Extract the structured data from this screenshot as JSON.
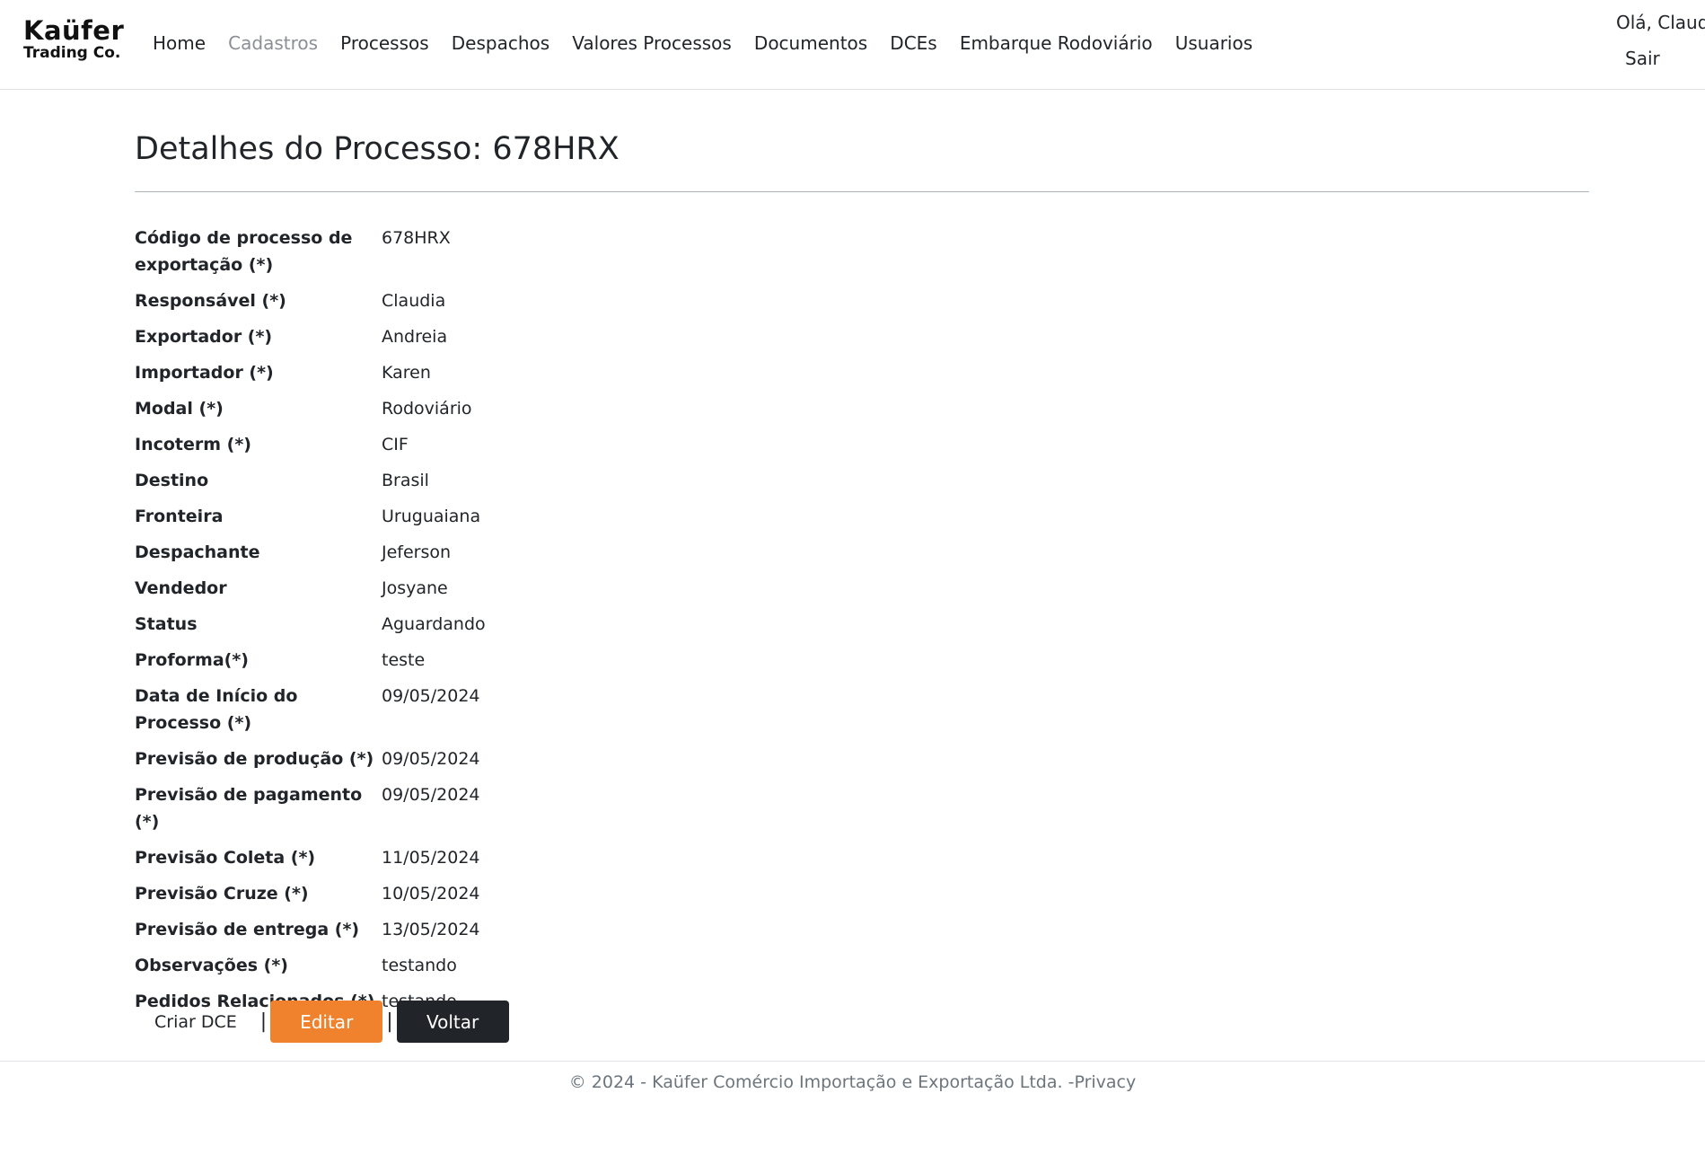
{
  "brand": {
    "line1": "Kaüfer",
    "line2": "Trading Co."
  },
  "nav": {
    "items": [
      {
        "label": "Home"
      },
      {
        "label": "Cadastros"
      },
      {
        "label": "Processos"
      },
      {
        "label": "Despachos"
      },
      {
        "label": "Valores Processos"
      },
      {
        "label": "Documentos"
      },
      {
        "label": "DCEs"
      },
      {
        "label": "Embarque Rodoviário"
      },
      {
        "label": "Usuarios"
      }
    ],
    "greeting": "Olá, Claudia",
    "logout": "Sair"
  },
  "page": {
    "title": "Detalhes do Processo: 678HRX"
  },
  "details": [
    {
      "label": "Código de processo de exportação (*)",
      "value": "678HRX"
    },
    {
      "label": "Responsável (*)",
      "value": "Claudia"
    },
    {
      "label": "Exportador (*)",
      "value": "Andreia"
    },
    {
      "label": "Importador (*)",
      "value": "Karen"
    },
    {
      "label": "Modal (*)",
      "value": "Rodoviário"
    },
    {
      "label": "Incoterm (*)",
      "value": "CIF"
    },
    {
      "label": "Destino",
      "value": "Brasil"
    },
    {
      "label": "Fronteira",
      "value": "Uruguaiana"
    },
    {
      "label": "Despachante",
      "value": "Jeferson"
    },
    {
      "label": "Vendedor",
      "value": "Josyane"
    },
    {
      "label": "Status",
      "value": "Aguardando"
    },
    {
      "label": "Proforma(*)",
      "value": "teste"
    },
    {
      "label": "Data de Início do Processo (*)",
      "value": "09/05/2024"
    },
    {
      "label": "Previsão de produção (*)",
      "value": "09/05/2024"
    },
    {
      "label": "Previsão de pagamento (*)",
      "value": "09/05/2024"
    },
    {
      "label": "Previsão Coleta (*)",
      "value": "11/05/2024"
    },
    {
      "label": "Previsão Cruze (*)",
      "value": "10/05/2024"
    },
    {
      "label": "Previsão de entrega (*)",
      "value": "13/05/2024"
    },
    {
      "label": "Observações (*)",
      "value": "testando"
    },
    {
      "label": "Pedidos Relacionados (*)",
      "value": "testando"
    }
  ],
  "actions": {
    "create_dce": "Criar DCE",
    "separator": "|",
    "edit": "Editar",
    "back": "Voltar"
  },
  "footer": {
    "text": "© 2024 - Kaüfer Comércio Importação e Exportação Ltda. -",
    "privacy": "Privacy"
  },
  "colors": {
    "edit_button": "#f0822d",
    "back_button": "#212529"
  }
}
